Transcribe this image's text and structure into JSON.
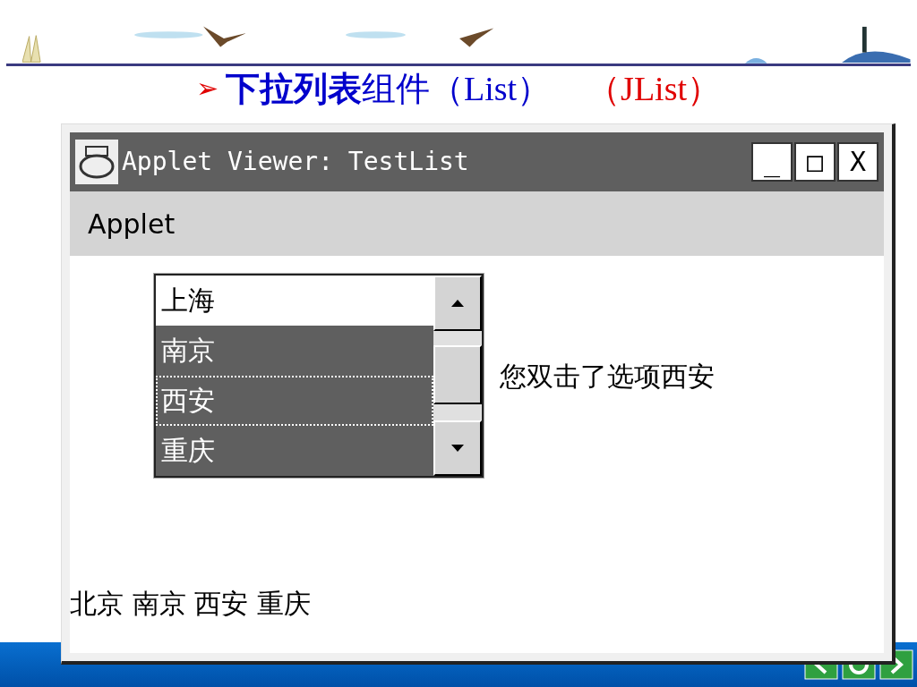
{
  "slide_title": {
    "bullet": "➢",
    "text": "**下拉列表**组件（List）",
    "note": "（JList）"
  },
  "window": {
    "title": "Applet Viewer: TestList",
    "controls": [
      "_",
      "□",
      "X"
    ]
  },
  "menu_bar": [
    "Applet"
  ],
  "list": {
    "items": [
      {
        "label": "上海",
        "selected": false,
        "focused": false
      },
      {
        "label": "南京",
        "selected": true,
        "focused": false
      },
      {
        "label": "西安",
        "selected": true,
        "focused": true
      },
      {
        "label": "重庆",
        "selected": true,
        "focused": false
      }
    ]
  },
  "message": "您双击了选项西安",
  "result": "北京 南京 西安 重庆"
}
